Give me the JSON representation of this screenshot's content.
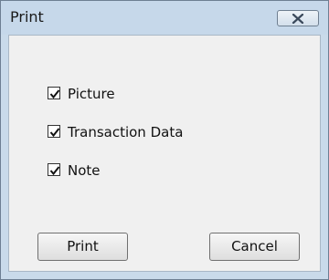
{
  "window": {
    "title": "Print"
  },
  "options": [
    {
      "label": "Picture",
      "checked": true
    },
    {
      "label": "Transaction Data",
      "checked": true
    },
    {
      "label": "Note",
      "checked": true
    }
  ],
  "buttons": {
    "print_label": "Print",
    "cancel_label": "Cancel"
  },
  "icons": {
    "close": "close-icon",
    "check": "checkmark-icon"
  }
}
